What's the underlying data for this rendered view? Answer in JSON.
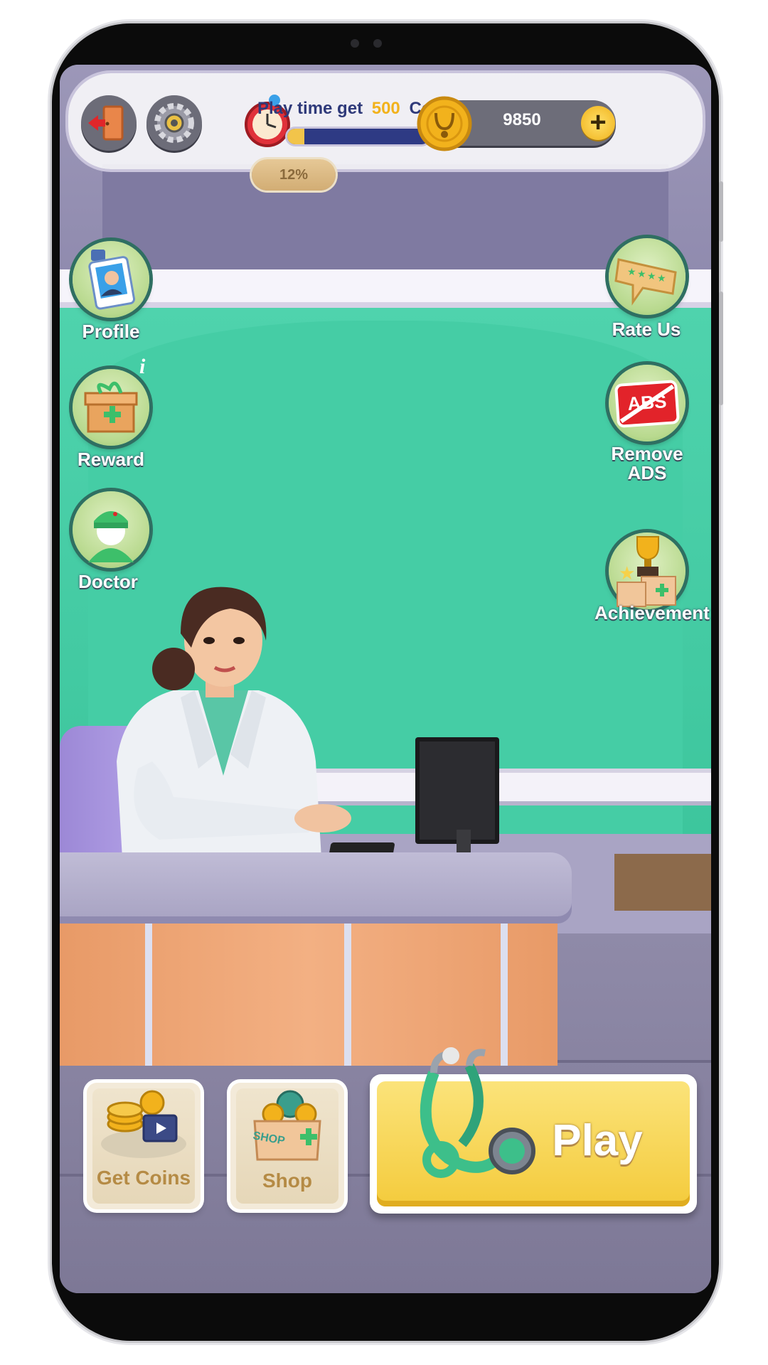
{
  "hud": {
    "playtime_text": "Play time get",
    "playtime_amount": "500",
    "playtime_suffix": "Coins.",
    "progress_label": "12%",
    "progress_value": 0.12,
    "coins": "9850"
  },
  "side_left": [
    {
      "label": "Profile",
      "icon": "profile-badge-icon"
    },
    {
      "label": "Reward",
      "icon": "gift-box-icon",
      "badge": "i"
    },
    {
      "label": "Doctor",
      "icon": "doctor-avatar-icon"
    }
  ],
  "side_right": [
    {
      "label": "Rate Us",
      "icon": "rating-stars-icon"
    },
    {
      "label": "Remove ADS",
      "icon": "no-ads-icon",
      "icon_text": "ABS"
    },
    {
      "label": "Achievement",
      "icon": "trophy-icon"
    }
  ],
  "bottom": {
    "get_coins_label": "Get Coins",
    "shop_label": "Shop",
    "shop_box_text": "SHOP",
    "play_label": "Play"
  },
  "colors": {
    "wall_green": "#3fcaa0",
    "play_yellow": "#f6d14a",
    "hud_bar_blue": "#2e3a84",
    "coin_gold": "#f2b21c"
  }
}
